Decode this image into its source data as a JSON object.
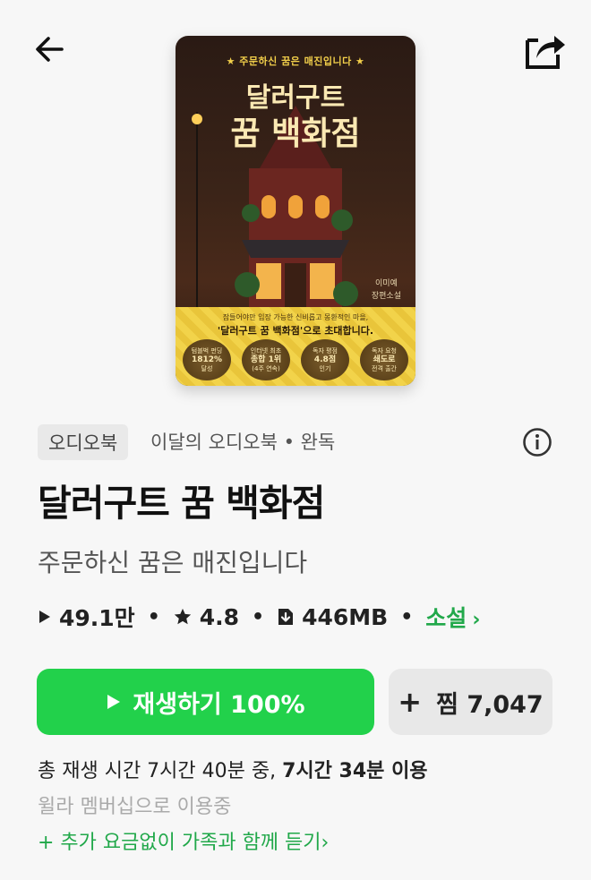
{
  "cover": {
    "top_text": "★ 주문하신 꿈은 매진입니다 ★",
    "title_line1": "달러구트",
    "title_line2": "꿈 백화점",
    "author": "이미예\n장편소설",
    "band_line1": "잠들어야만 입장 가능한 신비롭고 몽환적인 마을,",
    "band_line2": "'달러구트 꿈 백화점'으로 초대합니다.",
    "badges": [
      {
        "top": "텀블벅 펀딩",
        "main": "1812%",
        "bottom": "달성"
      },
      {
        "top": "인터넷 최초",
        "main": "종합 1위",
        "bottom": "(4주 연속)"
      },
      {
        "top": "독자 평점",
        "main": "4.8점",
        "bottom": "인기"
      },
      {
        "top": "독자 요청",
        "main": "쇄도로",
        "bottom": "전격 출간"
      }
    ]
  },
  "tag": "오디오북",
  "meta_text": "이달의 오디오북 • 완독",
  "title": "달러구트 꿈 백화점",
  "subtitle": "주문하신 꿈은 매진입니다",
  "stats": {
    "plays": "49.1만",
    "rating": "4.8",
    "size": "446MB",
    "genre": "소설",
    "sep": "•"
  },
  "buttons": {
    "play_label": "재생하기 100%",
    "wish_plus": "+",
    "wish_label": "찜 7,047"
  },
  "total": {
    "prefix": "총 재생 시간 7시간 40분 중, ",
    "used": "7시간 34분 이용"
  },
  "member_text": "윌라 멤버십으로 이용중",
  "family_link": "+ 추가 요금없이 가족과 함께 듣기",
  "chevron": "›",
  "colors": {
    "accent_green": "#22d14b",
    "link_green": "#21a84a"
  },
  "icons": [
    "back-arrow-icon",
    "share-icon",
    "info-icon",
    "play-icon",
    "star-icon",
    "download-icon",
    "chevron-right-icon"
  ]
}
